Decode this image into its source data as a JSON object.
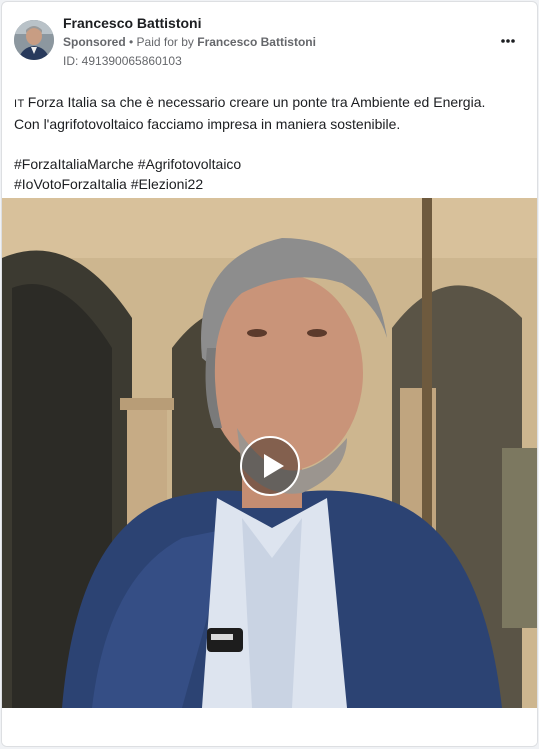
{
  "post": {
    "author": "Francesco Battistoni",
    "sponsored": "Sponsored",
    "separator": " • ",
    "paid_prefix": "Paid for by ",
    "paid_by": "Francesco Battistoni",
    "ad_id": "ID: 491390065860103",
    "language_code": "IT",
    "text_line1": "Forza Italia sa che è necessario creare un ponte tra Ambiente ed Energia.",
    "text_line2": "Con l'agrifotovoltaico facciamo impresa in maniera sostenibile.",
    "hashtags_line1": "#ForzaItaliaMarche #Agrifotovoltaico",
    "hashtags_line2": "#IoVotoForzaItalia #Elezioni22"
  },
  "icons": {
    "more": "more-options-icon",
    "play": "play-icon"
  },
  "colors": {
    "text": "#1c1e21",
    "muted": "#65676b",
    "card": "#ffffff",
    "page": "#f0f2f5"
  }
}
